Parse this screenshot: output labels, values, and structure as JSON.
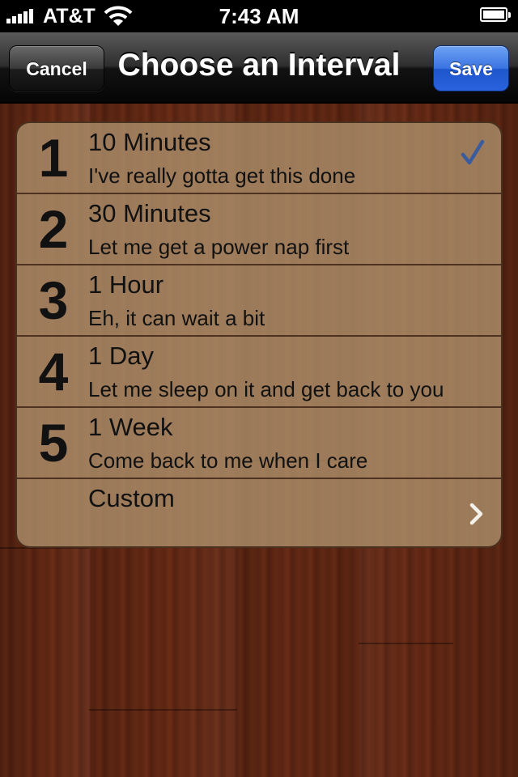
{
  "status_bar": {
    "carrier": "AT&T",
    "time": "7:43 AM",
    "signal_icon": "signal-bars-icon",
    "wifi_icon": "wifi-icon",
    "battery_icon": "battery-icon",
    "battery_level": 1.0
  },
  "nav": {
    "title": "Choose an Interval",
    "cancel_label": "Cancel",
    "save_label": "Save"
  },
  "intervals": [
    {
      "number": "1",
      "title": "10 Minutes",
      "subtitle": "I've really gotta get this done",
      "selected": true
    },
    {
      "number": "2",
      "title": "30 Minutes",
      "subtitle": "Let me get a power nap first",
      "selected": false
    },
    {
      "number": "3",
      "title": "1 Hour",
      "subtitle": "Eh, it can wait a bit",
      "selected": false
    },
    {
      "number": "4",
      "title": "1 Day",
      "subtitle": "Let me sleep on it and get back to you",
      "selected": false
    },
    {
      "number": "5",
      "title": "1 Week",
      "subtitle": "Come back to me when I care",
      "selected": false
    }
  ],
  "custom": {
    "title": "Custom",
    "accessory_icon": "chevron-right-icon"
  },
  "colors": {
    "checkmark": "#3a5c9c",
    "save_button": "#2a62de",
    "table_background": "#af946e",
    "wood": "#5a2413"
  }
}
